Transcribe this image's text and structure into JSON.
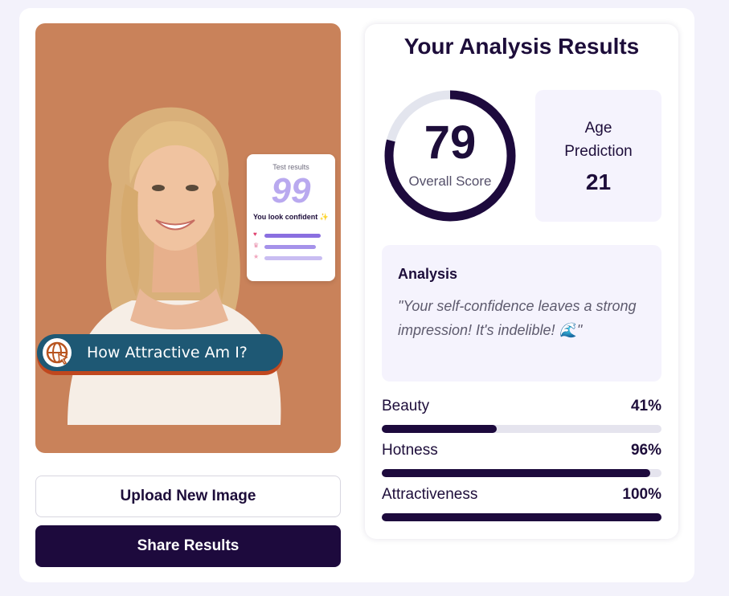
{
  "overlay": {
    "test_card": {
      "title": "Test results",
      "score": "99",
      "caption": "You look confident",
      "sparkle": "✨"
    },
    "badge": {
      "label": "How Attractive Am I?"
    }
  },
  "buttons": {
    "upload": "Upload New Image",
    "share": "Share Results"
  },
  "results": {
    "title": "Your Analysis Results",
    "overall_score": {
      "value": 79,
      "label": "Overall Score",
      "max": 100
    },
    "age": {
      "label": "Age Prediction",
      "value": "21"
    },
    "analysis": {
      "title": "Analysis",
      "text": "\"Your self-confidence leaves a strong impression! It's indelible! 🌊\""
    },
    "metrics": [
      {
        "name": "Beauty",
        "value": 41,
        "label": "41%"
      },
      {
        "name": "Hotness",
        "value": 96,
        "label": "96%"
      },
      {
        "name": "Attractiveness",
        "value": 100,
        "label": "100%"
      }
    ]
  },
  "colors": {
    "accent": "#1d0a3d",
    "ring_track": "#e3e5ee",
    "photo_bg": "#c9825a",
    "badge_bg": "#1e5874",
    "badge_shadow": "#c0471e"
  },
  "icons": {
    "badge_logo": "globe-cursor-icon"
  }
}
